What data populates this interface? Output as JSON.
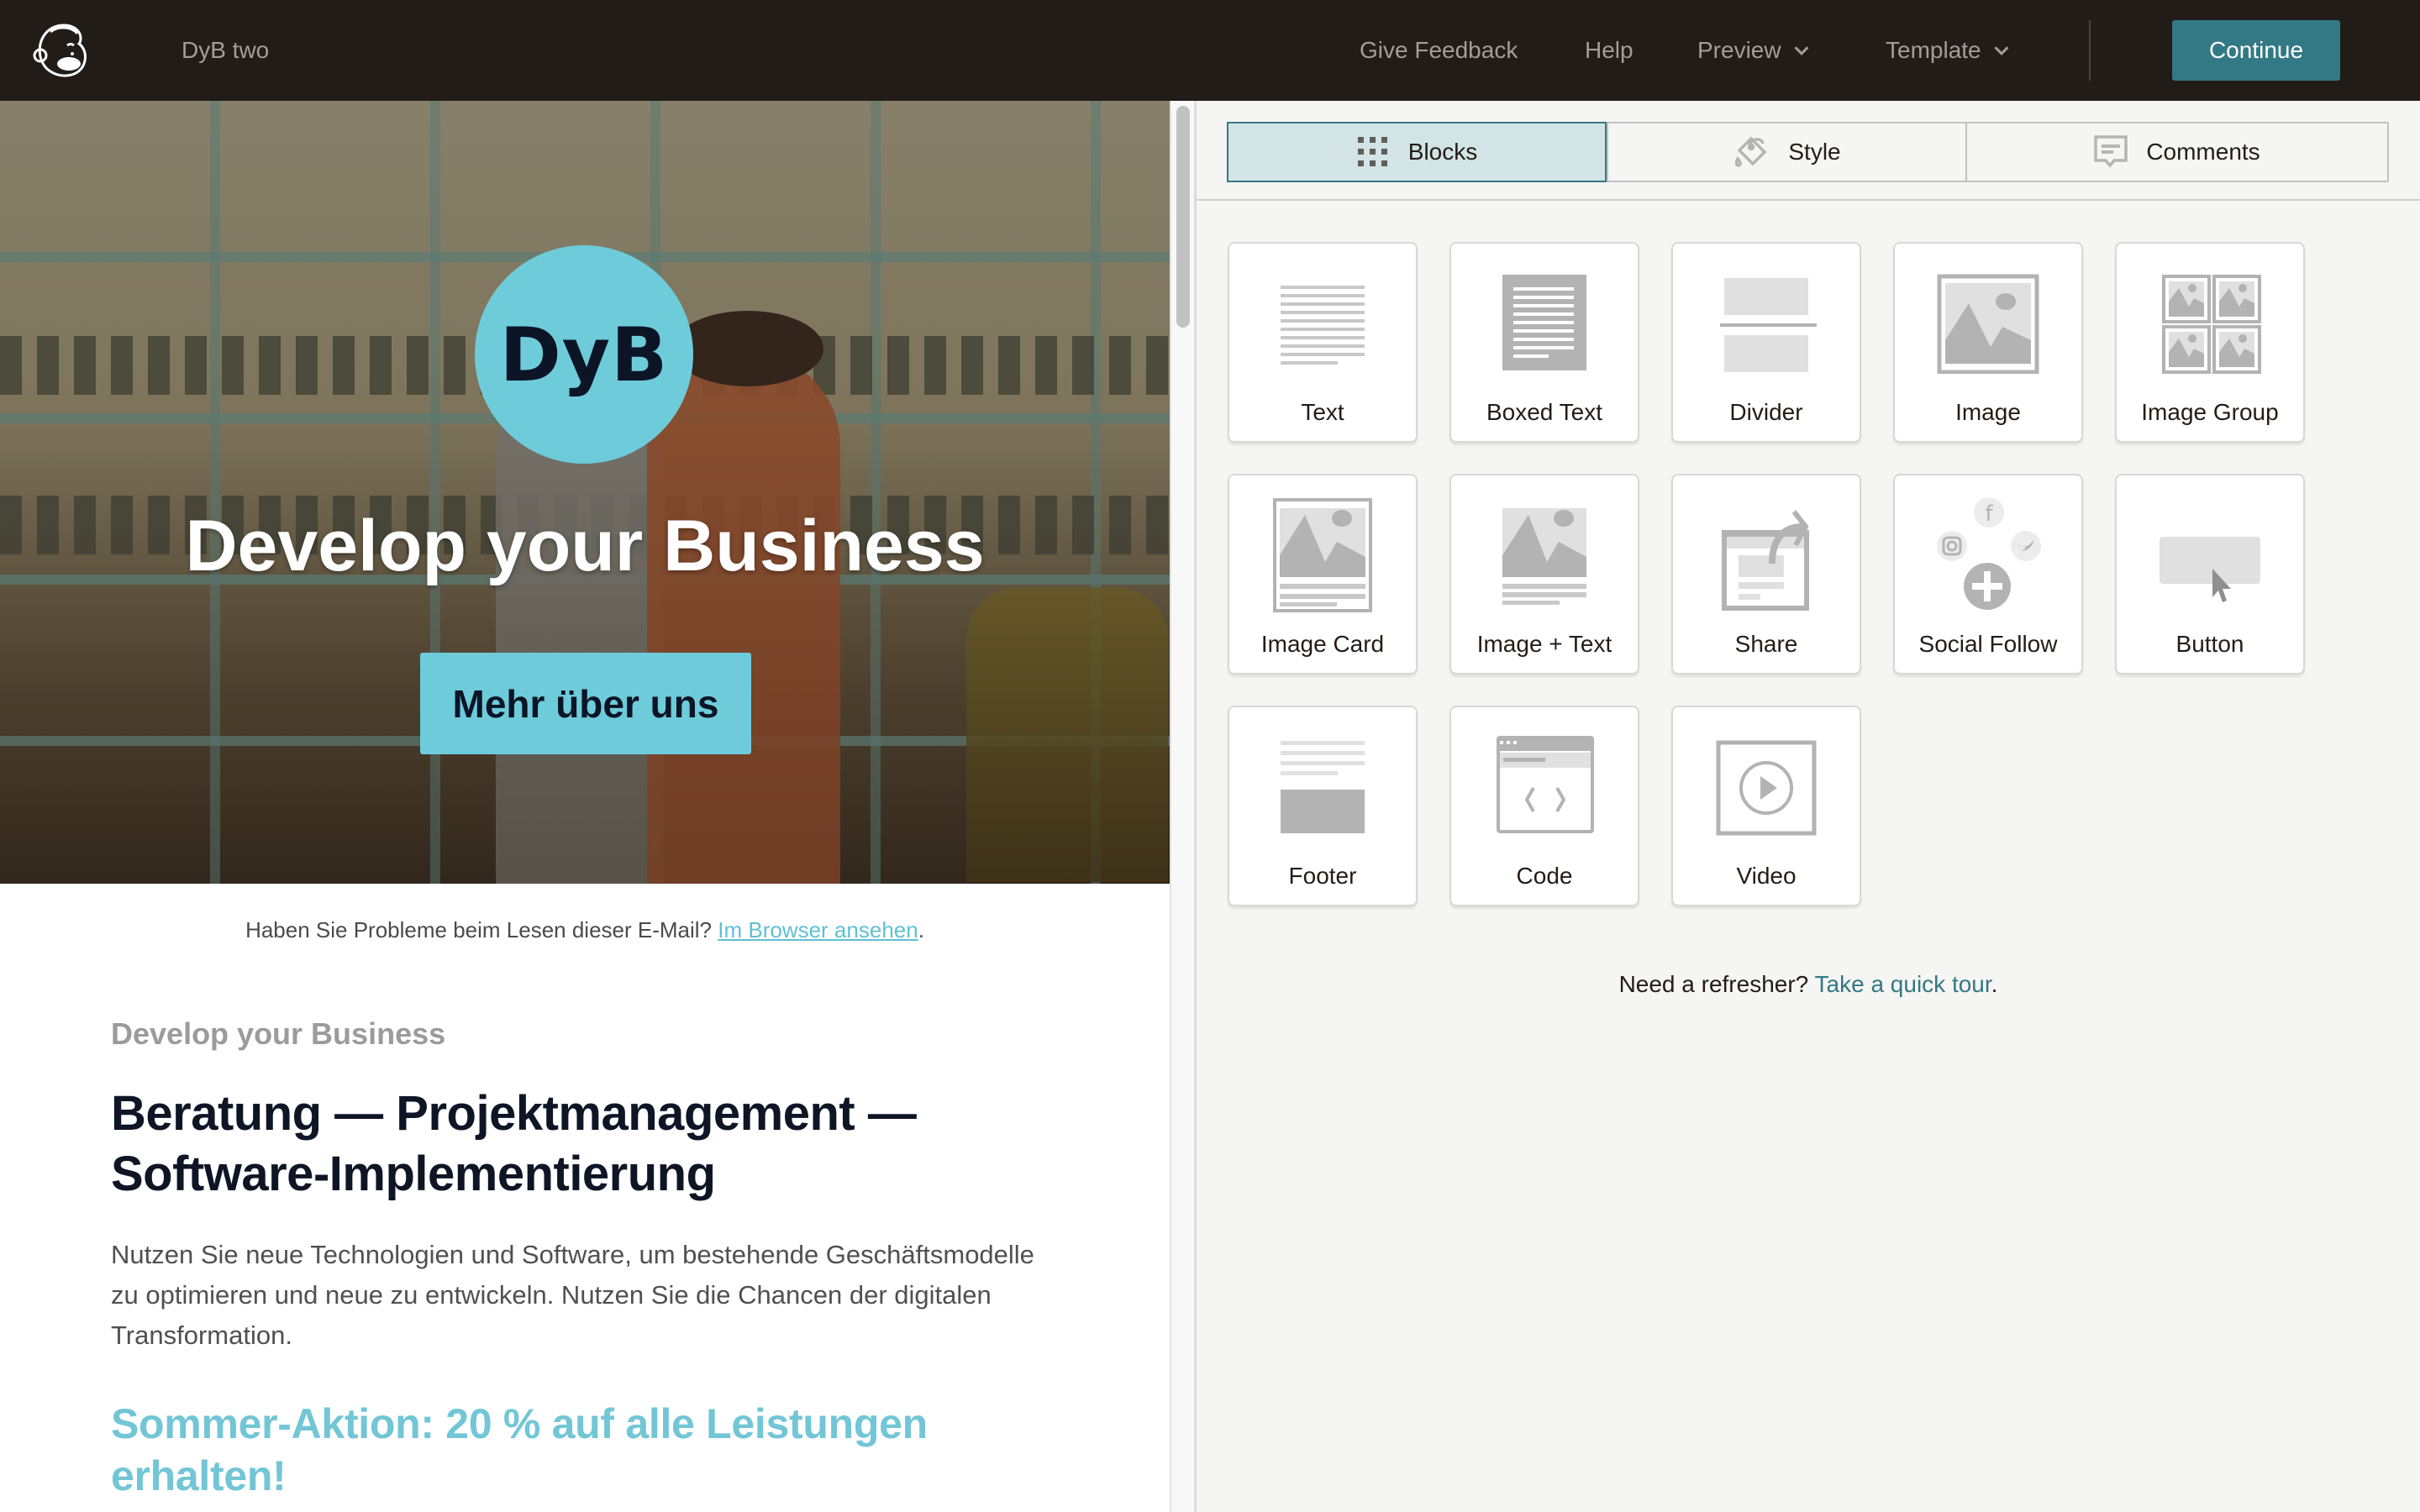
{
  "topbar": {
    "logo_icon": "mailchimp-freddie-icon",
    "campaign_name": "DyB two",
    "nav": {
      "give_feedback": "Give Feedback",
      "help": "Help",
      "preview": "Preview",
      "template": "Template"
    },
    "continue_label": "Continue",
    "accent_color": "#337985"
  },
  "email": {
    "hero": {
      "logo_text": "DyB",
      "title": "Develop your Business",
      "button_label": "Mehr über uns",
      "brand_color": "#6ecbda"
    },
    "preheader": {
      "text": "Haben Sie Probleme beim Lesen dieser E-Mail?",
      "link": "Im Browser ansehen",
      "suffix": "."
    },
    "kicker": "Develop your Business",
    "headline": "Beratung — Projektmanagement — Software-Implementierung",
    "body": "Nutzen Sie neue Technologien und Software, um bestehende Geschäftsmodelle zu optimieren und neue zu entwickeln. Nutzen Sie die Chancen der digitalen Transformation.",
    "promo": "Sommer-Aktion: 20 % auf alle Leistungen erhalten!"
  },
  "panel": {
    "tabs": [
      {
        "label": "Blocks",
        "icon": "grid-dots-icon",
        "active": true
      },
      {
        "label": "Style",
        "icon": "paint-bucket-icon",
        "active": false
      },
      {
        "label": "Comments",
        "icon": "comment-icon",
        "active": false
      }
    ],
    "blocks": [
      {
        "label": "Text",
        "icon": "text-block-icon"
      },
      {
        "label": "Boxed Text",
        "icon": "boxed-text-block-icon"
      },
      {
        "label": "Divider",
        "icon": "divider-block-icon"
      },
      {
        "label": "Image",
        "icon": "image-block-icon"
      },
      {
        "label": "Image Group",
        "icon": "image-group-block-icon"
      },
      {
        "label": "Image Card",
        "icon": "image-card-block-icon"
      },
      {
        "label": "Image + Text",
        "icon": "image-text-block-icon"
      },
      {
        "label": "Share",
        "icon": "share-block-icon"
      },
      {
        "label": "Social Follow",
        "icon": "social-follow-block-icon"
      },
      {
        "label": "Button",
        "icon": "button-block-icon"
      },
      {
        "label": "Footer",
        "icon": "footer-block-icon"
      },
      {
        "label": "Code",
        "icon": "code-block-icon"
      },
      {
        "label": "Video",
        "icon": "video-block-icon"
      }
    ],
    "refresher_text": "Need a refresher?",
    "refresher_link": "Take a quick tour",
    "refresher_suffix": "."
  }
}
